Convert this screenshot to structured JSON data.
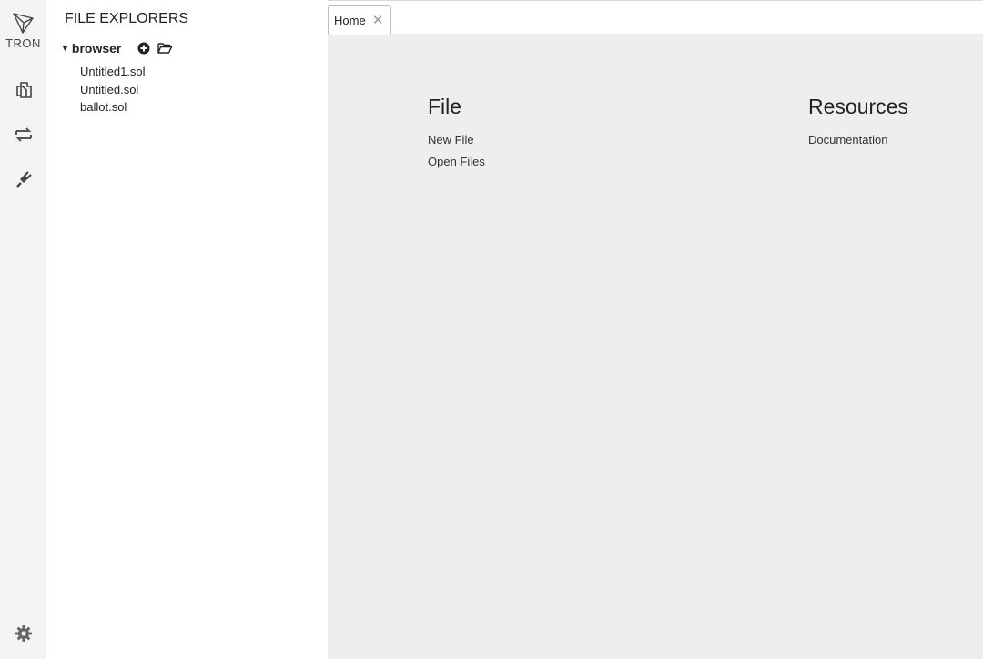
{
  "brand": {
    "logo_text": "TRON"
  },
  "sidebar": {
    "icons": [
      {
        "name": "file-explorer-icon"
      },
      {
        "name": "compile-icon"
      },
      {
        "name": "plugin-icon"
      }
    ],
    "settings_icon": "gear-icon"
  },
  "explorer": {
    "title": "FILE EXPLORERS",
    "root": {
      "label": "browser",
      "expanded": true
    },
    "files": [
      "Untitled1.sol",
      "Untitled.sol",
      "ballot.sol"
    ]
  },
  "tabs": [
    {
      "label": "Home",
      "close_glyph": "✕"
    }
  ],
  "home": {
    "file_section": {
      "title": "File",
      "links": [
        "New File",
        "Open Files"
      ]
    },
    "resources_section": {
      "title": "Resources",
      "links": [
        "Documentation"
      ]
    }
  },
  "colors": {
    "panel_bg": "#f4f4f5",
    "main_bg": "#edeef0",
    "text": "#222222"
  }
}
